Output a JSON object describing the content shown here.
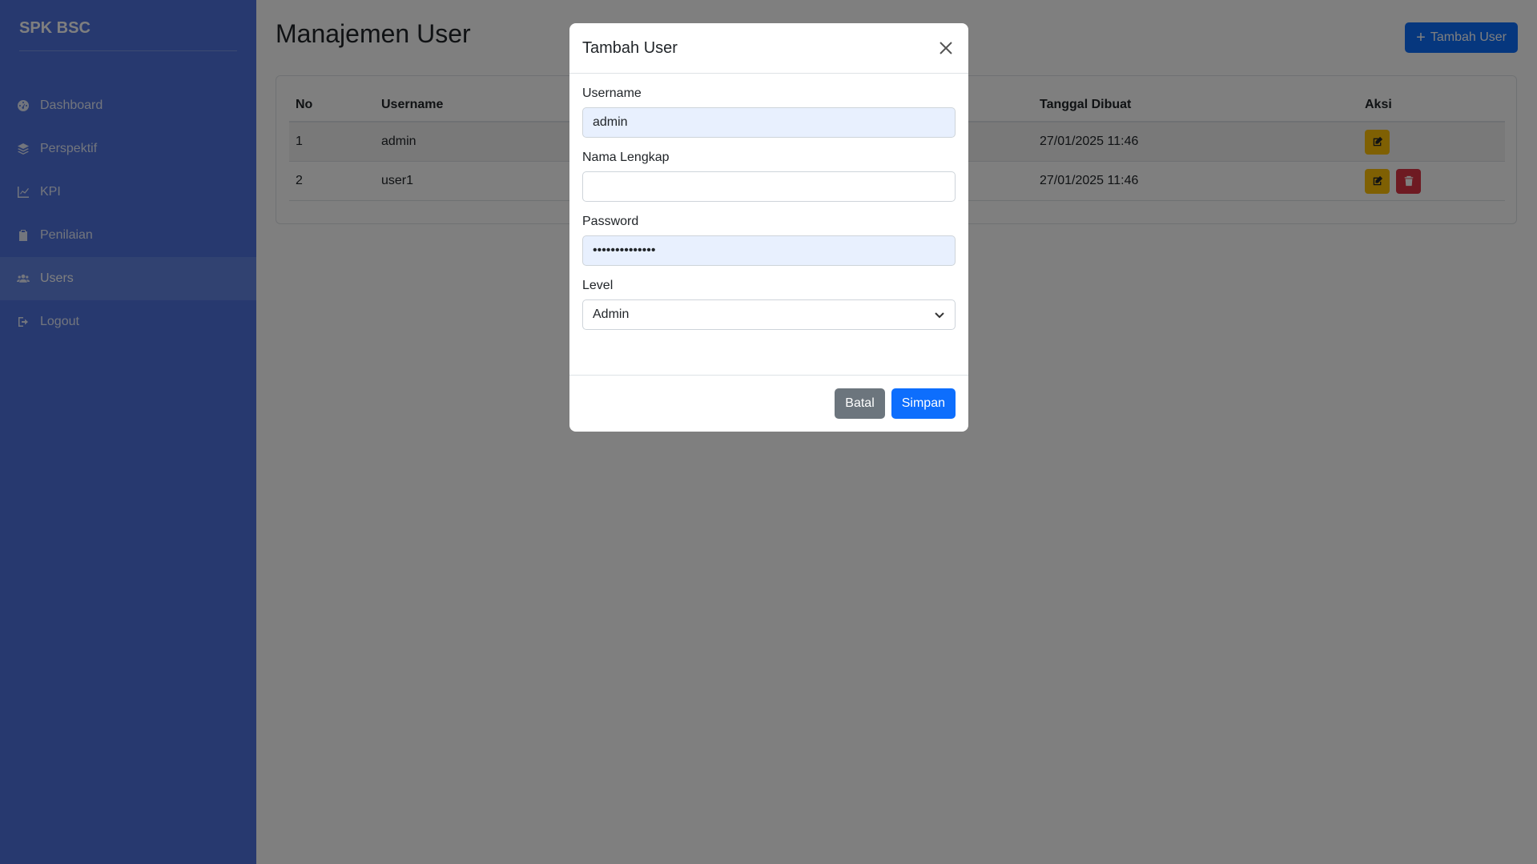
{
  "sidebar": {
    "brand": "SPK BSC",
    "items": [
      {
        "label": "Dashboard",
        "icon": "dashboard-icon"
      },
      {
        "label": "Perspektif",
        "icon": "layers-icon"
      },
      {
        "label": "KPI",
        "icon": "chart-line-icon"
      },
      {
        "label": "Penilaian",
        "icon": "clipboard-icon"
      },
      {
        "label": "Users",
        "icon": "users-icon",
        "active": true
      },
      {
        "label": "Logout",
        "icon": "logout-icon"
      }
    ]
  },
  "main": {
    "title": "Manajemen User",
    "add_button": "Tambah User",
    "table": {
      "headers": [
        "No",
        "Username",
        "",
        "Tanggal Dibuat",
        "Aksi"
      ],
      "rows": [
        {
          "no": "1",
          "username": "admin",
          "created": "27/01/2025 11:46"
        },
        {
          "no": "2",
          "username": "user1",
          "created": "27/01/2025 11:46"
        }
      ]
    }
  },
  "modal": {
    "title": "Tambah User",
    "fields": {
      "username": {
        "label": "Username",
        "value": "admin"
      },
      "nama": {
        "label": "Nama Lengkap",
        "value": ""
      },
      "password": {
        "label": "Password",
        "value": "••••••••••••••"
      },
      "level": {
        "label": "Level",
        "value": "Admin"
      }
    },
    "cancel": "Batal",
    "save": "Simpan"
  },
  "colors": {
    "sidebar": "#4e73df",
    "primary": "#0d6efd",
    "warning": "#ffc107",
    "danger": "#dc3545",
    "secondary": "#6c757d"
  }
}
